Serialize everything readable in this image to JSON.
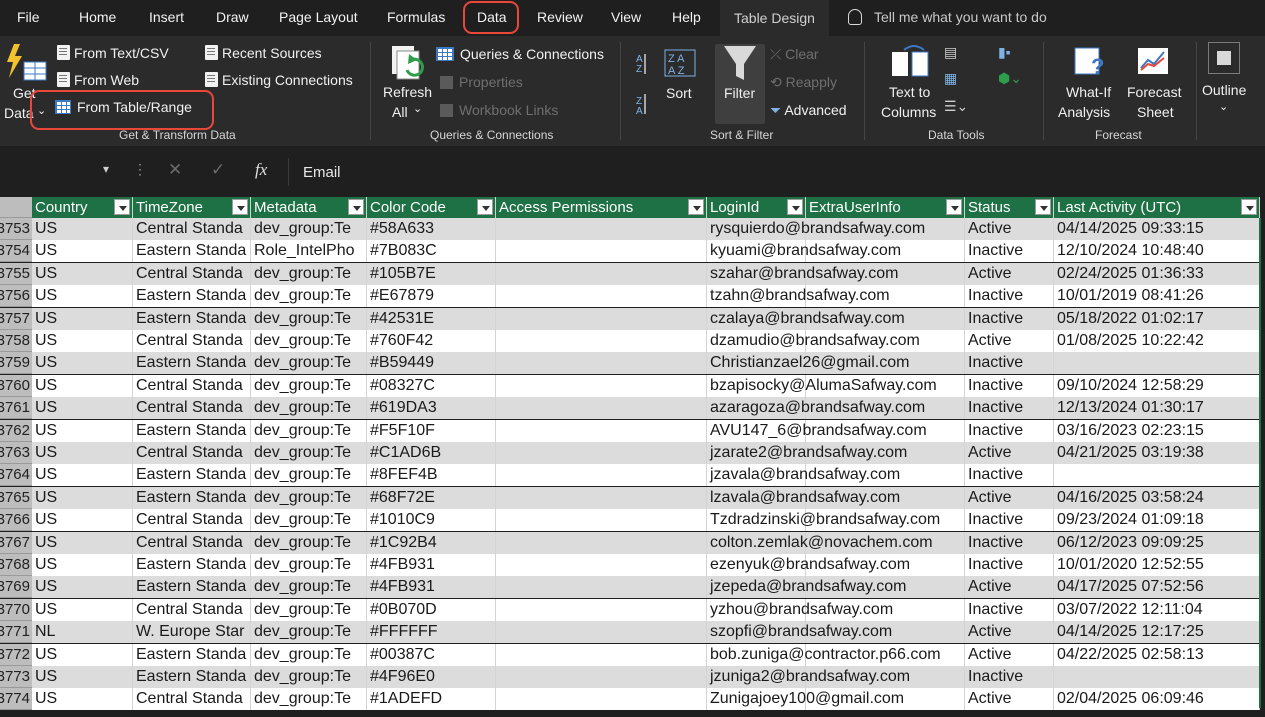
{
  "menu": {
    "tabs": [
      "File",
      "Home",
      "Insert",
      "Draw",
      "Page Layout",
      "Formulas",
      "Data",
      "Review",
      "View",
      "Help",
      "Table Design"
    ],
    "active_tab": "Data",
    "tell_me": "Tell me what you want to do"
  },
  "ribbon": {
    "get_data_line1": "Get",
    "get_data_line2": "Data",
    "from_text_csv": "From Text/CSV",
    "from_web": "From Web",
    "from_table_range": "From Table/Range",
    "recent_sources": "Recent Sources",
    "existing_connections": "Existing Connections",
    "group_get_transform": "Get & Transform Data",
    "refresh_all_line1": "Refresh",
    "refresh_all_line2": "All",
    "queries_connections": "Queries & Connections",
    "properties": "Properties",
    "workbook_links": "Workbook Links",
    "group_queries": "Queries & Connections",
    "sort": "Sort",
    "filter": "Filter",
    "clear": "Clear",
    "reapply": "Reapply",
    "advanced": "Advanced",
    "group_sort_filter": "Sort & Filter",
    "text_to_columns_line1": "Text to",
    "text_to_columns_line2": "Columns",
    "group_data_tools": "Data Tools",
    "what_if_line1": "What-If",
    "what_if_line2": "Analysis",
    "forecast_sheet_line1": "Forecast",
    "forecast_sheet_line2": "Sheet",
    "group_forecast": "Forecast",
    "outline": "Outline"
  },
  "formula_bar": {
    "content": "Email"
  },
  "table": {
    "headers": [
      "Country",
      "TimeZone",
      "Metadata",
      "Color Code",
      "Access Permissions",
      "LoginId",
      "ExtraUserInfo",
      "Status",
      "Last Activity (UTC)"
    ],
    "rows": [
      {
        "num": "3753",
        "cells": [
          "US",
          "Central Standa",
          "dev_group:Te",
          "#58A633",
          "",
          "rysquierdo@brandsafway.com",
          "",
          "Active",
          "04/14/2025 09:33:15"
        ]
      },
      {
        "num": "3754",
        "cells": [
          "US",
          "Eastern Standa",
          "Role_IntelPho",
          "#7B083C",
          "",
          "kyuami@brandsafway.com",
          "",
          "Inactive",
          "12/10/2024 10:48:40"
        ]
      },
      {
        "num": "3755",
        "cells": [
          "US",
          "Central Standa",
          "dev_group:Te",
          "#105B7E",
          "",
          "szahar@brandsafway.com",
          "",
          "Active",
          "02/24/2025 01:36:33"
        ]
      },
      {
        "num": "3756",
        "cells": [
          "US",
          "Eastern Standa",
          "dev_group:Te",
          "#E67879",
          "",
          "tzahn@brandsafway.com",
          "",
          "Inactive",
          "10/01/2019 08:41:26"
        ]
      },
      {
        "num": "3757",
        "cells": [
          "US",
          "Eastern Standa",
          "dev_group:Te",
          "#42531E",
          "",
          "czalaya@brandsafway.com",
          "",
          "Inactive",
          "05/18/2022 01:02:17"
        ]
      },
      {
        "num": "3758",
        "cells": [
          "US",
          "Central Standa",
          "dev_group:Te",
          "#760F42",
          "",
          "dzamudio@brandsafway.com",
          "",
          "Active",
          "01/08/2025 10:22:42"
        ]
      },
      {
        "num": "3759",
        "cells": [
          "US",
          "Eastern Standa",
          "dev_group:Te",
          "#B59449",
          "",
          "Christianzael26@gmail.com",
          "",
          "Inactive",
          ""
        ]
      },
      {
        "num": "3760",
        "cells": [
          "US",
          "Central Standa",
          "dev_group:Te",
          "#08327C",
          "",
          "bzapisocky@AlumaSafway.com",
          "",
          "Inactive",
          "09/10/2024 12:58:29"
        ]
      },
      {
        "num": "3761",
        "cells": [
          "US",
          "Central Standa",
          "dev_group:Te",
          "#619DA3",
          "",
          "azaragoza@brandsafway.com",
          "",
          "Inactive",
          "12/13/2024 01:30:17"
        ]
      },
      {
        "num": "3762",
        "cells": [
          "US",
          "Eastern Standa",
          "dev_group:Te",
          "#F5F10F",
          "",
          "AVU147_6@brandsafway.com",
          "",
          "Inactive",
          "03/16/2023 02:23:15"
        ]
      },
      {
        "num": "3763",
        "cells": [
          "US",
          "Central Standa",
          "dev_group:Te",
          "#C1AD6B",
          "",
          "jzarate2@brandsafway.com",
          "",
          "Active",
          "04/21/2025 03:19:38"
        ]
      },
      {
        "num": "3764",
        "cells": [
          "US",
          "Eastern Standa",
          "dev_group:Te",
          "#8FEF4B",
          "",
          "jzavala@brandsafway.com",
          "",
          "Inactive",
          ""
        ]
      },
      {
        "num": "3765",
        "cells": [
          "US",
          "Eastern Standa",
          "dev_group:Te",
          "#68F72E",
          "",
          "lzavala@brandsafway.com",
          "",
          "Active",
          "04/16/2025 03:58:24"
        ]
      },
      {
        "num": "3766",
        "cells": [
          "US",
          "Central Standa",
          "dev_group:Te",
          "#1010C9",
          "",
          "Tzdradzinski@brandsafway.com",
          "",
          "Inactive",
          "09/23/2024 01:09:18"
        ]
      },
      {
        "num": "3767",
        "cells": [
          "US",
          "Central Standa",
          "dev_group:Te",
          "#1C92B4",
          "",
          "colton.zemlak@novachem.com",
          "",
          "Inactive",
          "06/12/2023 09:09:25"
        ]
      },
      {
        "num": "3768",
        "cells": [
          "US",
          "Eastern Standa",
          "dev_group:Te",
          "#4FB931",
          "",
          "ezenyuk@brandsafway.com",
          "",
          "Inactive",
          "10/01/2020 12:52:55"
        ]
      },
      {
        "num": "3769",
        "cells": [
          "US",
          "Eastern Standa",
          "dev_group:Te",
          "#4FB931",
          "",
          "jzepeda@brandsafway.com",
          "",
          "Active",
          "04/17/2025 07:52:56"
        ]
      },
      {
        "num": "3770",
        "cells": [
          "US",
          "Central Standa",
          "dev_group:Te",
          "#0B070D",
          "",
          "yzhou@brandsafway.com",
          "",
          "Inactive",
          "03/07/2022 12:11:04"
        ]
      },
      {
        "num": "3771",
        "cells": [
          "NL",
          "W. Europe Star",
          "dev_group:Te",
          "#FFFFFF",
          "",
          "szopfi@brandsafway.com",
          "",
          "Active",
          "04/14/2025 12:17:25"
        ]
      },
      {
        "num": "3772",
        "cells": [
          "US",
          "Eastern Standa",
          "dev_group:Te",
          "#00387C",
          "",
          "bob.zuniga@contractor.p66.com",
          "",
          "Active",
          "04/22/2025 02:58:13"
        ]
      },
      {
        "num": "3773",
        "cells": [
          "US",
          "Eastern Standa",
          "dev_group:Te",
          "#4F96E0",
          "",
          "jzuniga2@brandsafway.com",
          "",
          "Inactive",
          ""
        ]
      },
      {
        "num": "3774",
        "cells": [
          "US",
          "Central Standa",
          "dev_group:Te",
          "#1ADEFD",
          "",
          "Zunigajoey100@gmail.com",
          "",
          "Active",
          "02/04/2025 06:09:46"
        ]
      }
    ]
  },
  "colors": {
    "accent_red": "#e8473a",
    "header_green": "#1e7145"
  }
}
